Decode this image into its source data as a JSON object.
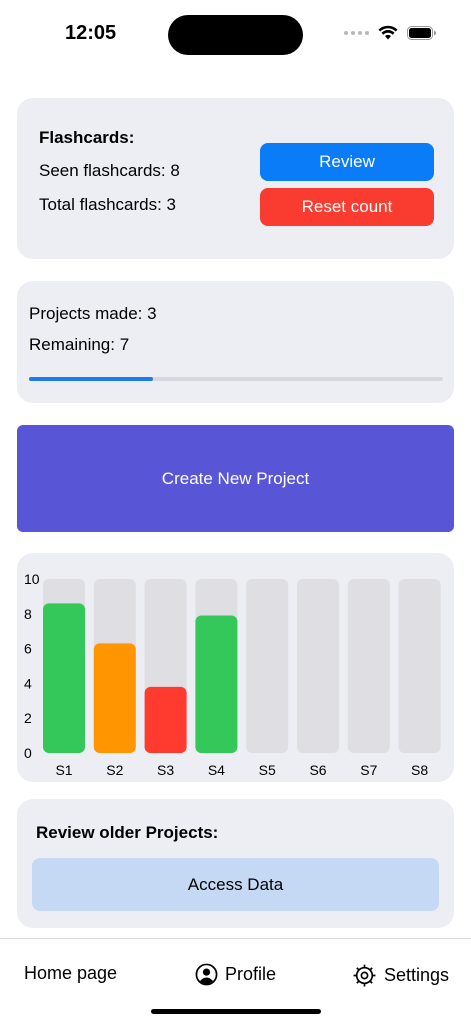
{
  "status_bar": {
    "time": "12:05"
  },
  "flashcards": {
    "title": "Flashcards:",
    "seen": "Seen flashcards: 8",
    "total": "Total flashcards: 3",
    "review_label": "Review",
    "reset_label": "Reset count",
    "review_color": "#0a7cf7",
    "reset_color": "#fa3b30"
  },
  "projects": {
    "made": "Projects made: 3",
    "remaining": "Remaining: 7",
    "progress": 0.3,
    "progress_color": "#1c7be6"
  },
  "create_button": {
    "label": "Create New Project",
    "color": "#5856d6"
  },
  "chart_data": {
    "type": "bar",
    "categories": [
      "S1",
      "S2",
      "S3",
      "S4",
      "S5",
      "S6",
      "S7",
      "S8"
    ],
    "values": [
      8.6,
      6.3,
      3.8,
      7.9,
      0,
      0,
      0,
      0
    ],
    "colors": [
      "#34c759",
      "#ff9500",
      "#ff3b30",
      "#34c759",
      null,
      null,
      null,
      null
    ],
    "track_color": "#dedee3",
    "ylim": [
      0,
      10
    ],
    "yticks": [
      "0",
      "2",
      "4",
      "6",
      "8",
      "10"
    ],
    "grid": false
  },
  "review_older": {
    "title": "Review older Projects:",
    "button_label": "Access Data",
    "button_color": "#c5d9f5"
  },
  "tab_bar": {
    "home": "Home page",
    "profile": "Profile",
    "settings": "Settings",
    "profile_icon": "person-circle-icon",
    "settings_icon": "gear-icon"
  }
}
